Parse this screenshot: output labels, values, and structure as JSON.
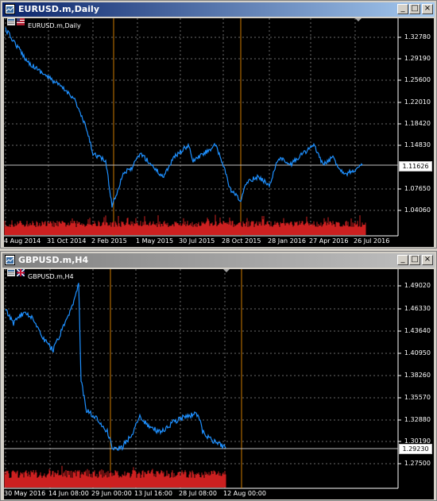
{
  "windows": [
    {
      "id": "eur",
      "title": "EURUSD.m,Daily",
      "symbol_label": "EURUSD.m,Daily",
      "active": true,
      "price_labels": [
        "1.32780",
        "1.29190",
        "1.25600",
        "1.22010",
        "1.18420",
        "1.14830",
        "1.07650",
        "1.04060"
      ],
      "current_price": "1.11626",
      "date_labels": [
        "4 Aug 2014",
        "31 Oct 2014",
        "2 Feb 2015",
        "1 May 2015",
        "30 Jul 2015",
        "28 Oct 2015",
        "28 Jan 2016",
        "27 Apr 2016",
        "26 Jul 2016"
      ]
    },
    {
      "id": "gbp",
      "title": "GBPUSD.m,H4",
      "symbol_label": "GBPUSD.m,H4",
      "active": false,
      "price_labels": [
        "1.49020",
        "1.46330",
        "1.43640",
        "1.40950",
        "1.38260",
        "1.35570",
        "1.32880",
        "1.30190",
        "1.27500"
      ],
      "current_price": "1.29230",
      "date_labels": [
        "30 May 2016",
        "14 Jun 08:00",
        "29 Jun 00:00",
        "13 Jul 16:00",
        "28 Jul 08:00",
        "12 Aug 00:00"
      ]
    }
  ],
  "window_buttons": {
    "minimize": "_",
    "maximize": "□",
    "close": "×"
  },
  "colors": {
    "price_line": "#1e90ff",
    "volume": "#cc2020",
    "grid": "#6a6a6a",
    "vline": "#cc7a00",
    "titlebar_active": "#0a246a"
  }
}
